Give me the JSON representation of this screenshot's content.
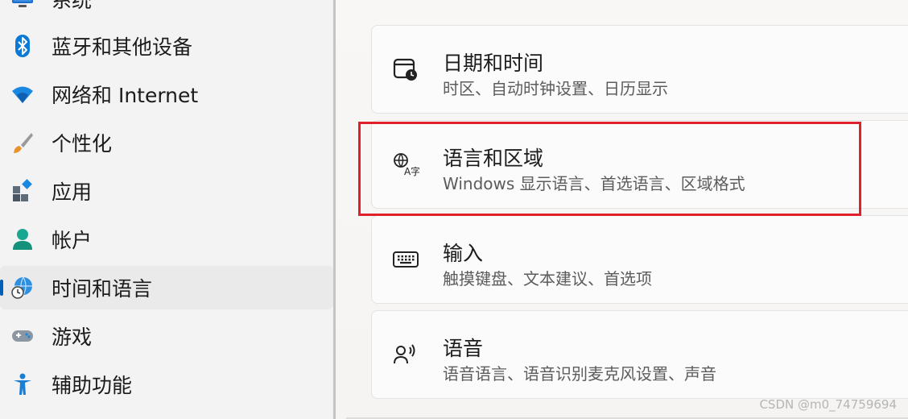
{
  "sidebar": {
    "items": [
      {
        "label": "系统",
        "icon": "monitor-icon"
      },
      {
        "label": "蓝牙和其他设备",
        "icon": "bluetooth-icon"
      },
      {
        "label": "网络和 Internet",
        "icon": "wifi-icon"
      },
      {
        "label": "个性化",
        "icon": "brush-icon"
      },
      {
        "label": "应用",
        "icon": "apps-icon"
      },
      {
        "label": "帐户",
        "icon": "account-icon"
      },
      {
        "label": "时间和语言",
        "icon": "globe-clock-icon",
        "selected": true
      },
      {
        "label": "游戏",
        "icon": "gamepad-icon"
      },
      {
        "label": "辅助功能",
        "icon": "accessibility-icon"
      }
    ]
  },
  "main": {
    "cards": [
      {
        "title": "日期和时间",
        "subtitle": "时区、自动时钟设置、日历显示",
        "icon": "calendar-clock-icon"
      },
      {
        "title": "语言和区域",
        "subtitle": "Windows 显示语言、首选语言、区域格式",
        "icon": "language-icon"
      },
      {
        "title": "输入",
        "subtitle": "触摸键盘、文本建议、首选项",
        "icon": "keyboard-icon"
      },
      {
        "title": "语音",
        "subtitle": "语音语言、语音识别麦克风设置、声音",
        "icon": "speech-icon"
      }
    ]
  },
  "watermark": "CSDN @m0_74759694",
  "colors": {
    "accent": "#005fb8",
    "highlight": "#e0202a"
  }
}
